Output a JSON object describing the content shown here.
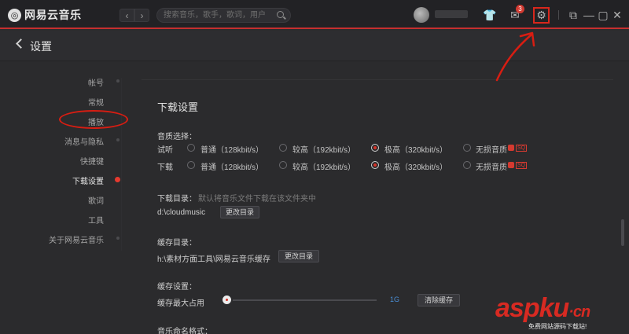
{
  "titlebar": {
    "app_name": "网易云音乐",
    "logo_glyph": "◎",
    "back_glyph": "‹",
    "fwd_glyph": "›",
    "search_placeholder": "搜索音乐，歌手，歌词，用户",
    "message_badge": "3",
    "skin_glyph": "👕",
    "msg_glyph": "✉",
    "settings_glyph": "⚙",
    "mini_glyph": "⧉",
    "min_glyph": "—",
    "max_glyph": "▢",
    "close_glyph": "✕",
    "accent_color": "#c62f2f"
  },
  "page": {
    "title": "设置"
  },
  "sidenav": {
    "items": [
      "帐号",
      "常规",
      "播放",
      "消息与隐私",
      "快捷键",
      "下载设置",
      "歌词",
      "工具",
      "关于网易云音乐"
    ],
    "active": "下载设置"
  },
  "download": {
    "section_title": "下载设置",
    "quality_label": "音质选择：",
    "rows": [
      {
        "label": "试听",
        "selected": 2
      },
      {
        "label": "下载",
        "selected": 2
      }
    ],
    "options": [
      "普通（128kbit/s）",
      "较高（192kbit/s）",
      "极高（320kbit/s）",
      "无损音质"
    ],
    "sq_tag": "SQ",
    "dir_label": "下载目录：",
    "dir_hint": "默认将音乐文件下载在该文件夹中",
    "dir_value": "d:\\cloudmusic",
    "change_dir": "更改目录",
    "cache_dir_label": "缓存目录：",
    "cache_dir_value": "h:\\素材方面工具\\网易云音乐缓存",
    "cache_change_dir": "更改目录",
    "cache_settings_label": "缓存设置：",
    "cache_max_label": "缓存最大占用",
    "cache_max_value": "1G",
    "cache_fraction": 0.02,
    "clear_cache": "清除缓存",
    "naming_label": "音乐命名格式："
  },
  "watermark": {
    "text": "aspku",
    "suffix": "·cn",
    "sub": "免费网站源码下载站!"
  }
}
